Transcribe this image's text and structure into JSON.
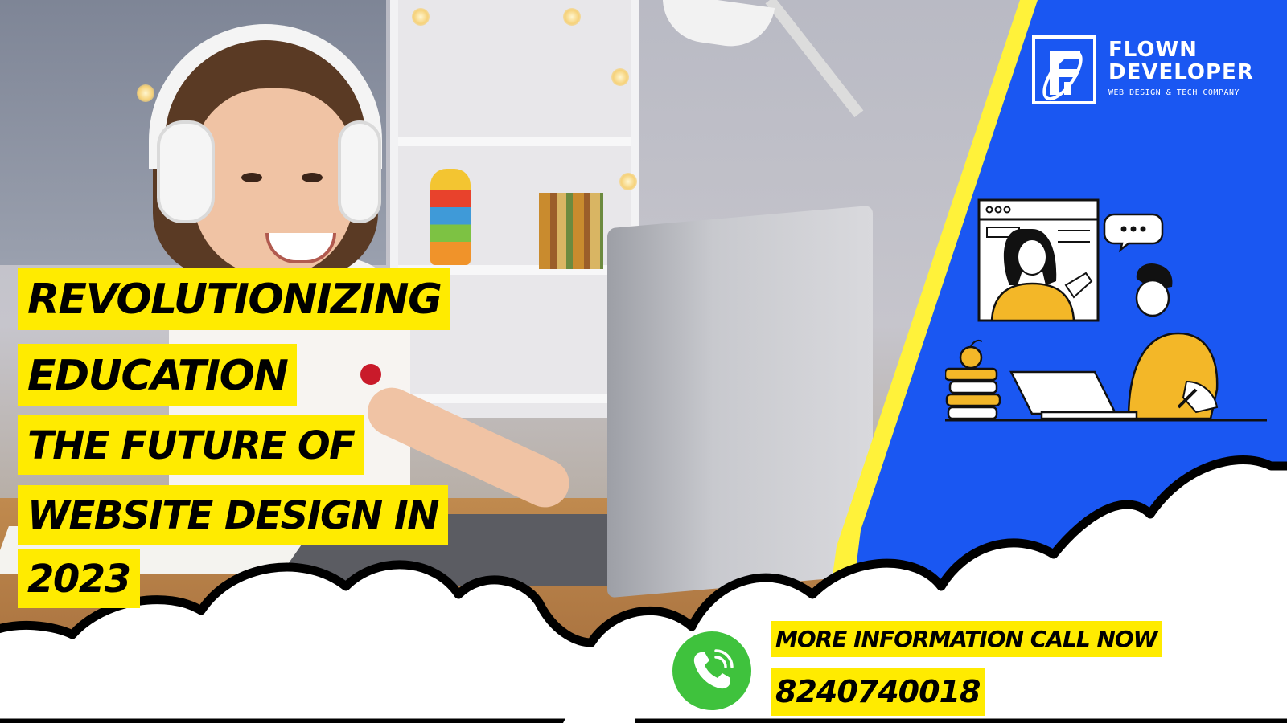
{
  "brand": {
    "name_line1": "FLOWN",
    "name_line2": "DEVELOPER",
    "tagline": "WEB DESIGN & TECH COMPANY",
    "logo_icon": "flown-f-logo-icon"
  },
  "headline": {
    "lines": [
      "REVOLUTIONIZING",
      "EDUCATION",
      "THE FUTURE OF",
      "WEBSITE DESIGN IN",
      "2023"
    ]
  },
  "cta": {
    "label": "MORE INFORMATION CALL NOW",
    "phone": "8240740018",
    "icon": "phone-call-icon"
  },
  "colors": {
    "highlight_yellow": "#ffeb00",
    "panel_blue": "#1a57f2",
    "stripe_yellow": "#fff23a",
    "phone_green": "#3fc23d",
    "text": "#000000"
  },
  "illustration": {
    "icon": "online-learning-illustration"
  }
}
